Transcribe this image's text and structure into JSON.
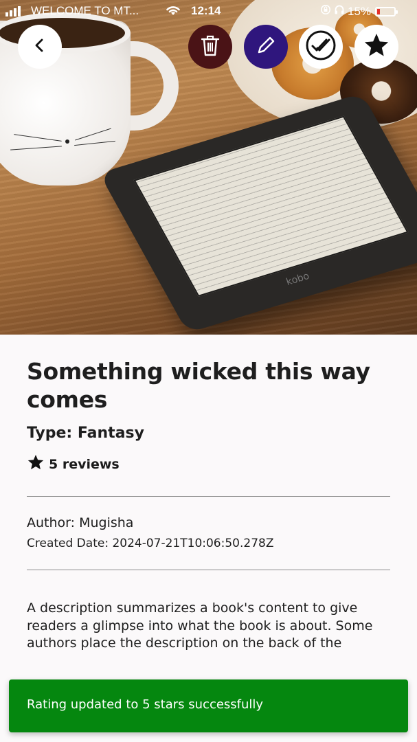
{
  "status_bar": {
    "carrier": "WELCOME TO MT...",
    "time": "12:14",
    "battery": "15%",
    "icons": [
      "signal-icon",
      "wifi-icon",
      "orientation-lock-icon",
      "headphones-icon",
      "battery-icon"
    ]
  },
  "actions": {
    "back_icon": "chevron-left-icon",
    "delete_icon": "trash-icon",
    "edit_icon": "pencil-icon",
    "done_icon": "double-check-icon",
    "star_icon": "star-icon",
    "colors": {
      "delete": "#4a1316",
      "edit": "#2f167d"
    }
  },
  "book": {
    "title": "Something wicked this way comes",
    "type": "Type: Fantasy",
    "reviews": "5 reviews",
    "author": "Author: Mugisha",
    "created": "Created Date: 2024-07-21T10:06:50.278Z",
    "description": "A description summarizes a book's content to give readers a glimpse into what the book is about. Some authors place the description on the back of the",
    "cover_brand": "kobo"
  },
  "toast": {
    "message": "Rating updated to 5 stars successfully",
    "color": "#05870f"
  }
}
